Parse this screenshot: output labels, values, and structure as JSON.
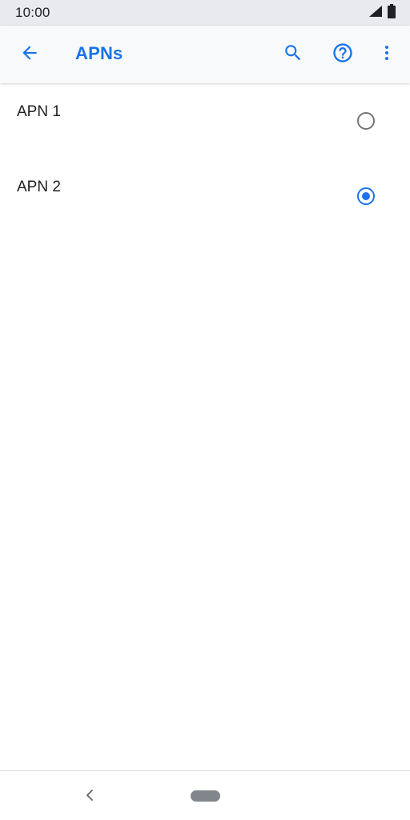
{
  "status_bar": {
    "time": "10:00",
    "icons": [
      "signal-icon",
      "battery-icon"
    ]
  },
  "app_bar": {
    "title": "APNs",
    "back_icon": "arrow-back-icon",
    "actions": [
      "search-icon",
      "help-icon",
      "more-vert-icon"
    ]
  },
  "apns": [
    {
      "label": "APN 1",
      "selected": false
    },
    {
      "label": "APN 2",
      "selected": true
    }
  ],
  "nav_bar": {
    "back_icon": "nav-back-icon",
    "home_icon": "home-pill-icon"
  },
  "colors": {
    "accent": "#1a73e8",
    "status_bar_bg": "#e8eaed",
    "app_bar_bg": "#f8f9fa",
    "text_primary": "#202124",
    "radio_off": "#757575"
  }
}
